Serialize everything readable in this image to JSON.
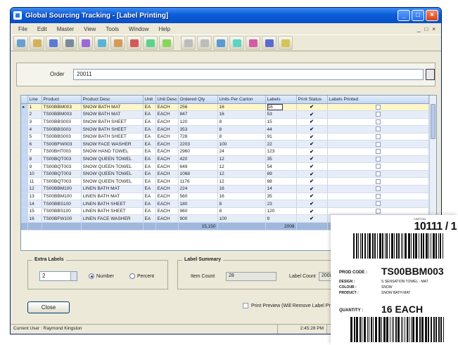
{
  "window": {
    "title": "Global Sourcing Tracking - [Label Printing]",
    "controls": [
      "_",
      "□",
      "×"
    ],
    "menu": [
      "File",
      "Edit",
      "Master",
      "View",
      "Tools",
      "Window",
      "Help"
    ],
    "mdi_controls": [
      "_",
      "□",
      "×"
    ]
  },
  "colors": {
    "titlebar": "#0b5cd8",
    "grid_header": "#c4d8f4",
    "selected_row": "#fff6c8",
    "alt_row": "#e6edf8",
    "total_row": "#9fb8dc"
  },
  "toolbar": {
    "buttons": [
      {
        "icon": "new-icon",
        "color": "#6a9fd4"
      },
      {
        "icon": "open-icon",
        "color": "#d4b25a"
      },
      {
        "icon": "save-icon",
        "color": "#5a7ad4"
      },
      {
        "icon": "print-icon",
        "color": "#7a8a9a"
      },
      {
        "icon": "cut-icon",
        "color": "#9a6ad4"
      },
      {
        "icon": "copy-icon",
        "color": "#5ab4d4"
      },
      {
        "icon": "paste-icon",
        "color": "#d49a5a"
      },
      {
        "icon": "delete-icon",
        "color": "#d45a5a"
      },
      {
        "icon": "find-icon",
        "color": "#5ad48a"
      },
      {
        "icon": "refresh-icon",
        "color": "#8ad45a"
      },
      {
        "icon": "first-icon",
        "color": "#bcbcbc"
      },
      {
        "icon": "prev-icon",
        "color": "#bcbcbc"
      },
      {
        "icon": "next-icon",
        "color": "#5a9ad4"
      },
      {
        "icon": "last-icon",
        "color": "#5ad4c4"
      },
      {
        "icon": "report-icon",
        "color": "#d45aa4"
      },
      {
        "icon": "help-icon",
        "color": "#5a6ad4"
      },
      {
        "icon": "exit-icon",
        "color": "#d4c45a"
      }
    ]
  },
  "order": {
    "label": "Order",
    "value": "20011"
  },
  "grid": {
    "columns": [
      "",
      "Line",
      "Product",
      "Product Desc",
      "Unit",
      "Unit Desc",
      "Ordered Qty",
      "Units Per Carton",
      "Labels",
      "Print Status",
      "Labels Printed"
    ],
    "rows": [
      [
        "1",
        "TS00BBM003",
        "SNOW BATH MAT",
        "EA",
        "EACH",
        "256",
        "16",
        "16",
        "✔",
        ""
      ],
      [
        "2",
        "TS00BBM003",
        "SNOW BATH MAT",
        "EA",
        "EACH",
        "847",
        "16",
        "53",
        "✔",
        ""
      ],
      [
        "3",
        "TS00BBS003",
        "SNOW BATH SHEET",
        "EA",
        "EACH",
        "120",
        "8",
        "15",
        "✔",
        ""
      ],
      [
        "4",
        "TS00BBS003",
        "SNOW BATH SHEET",
        "EA",
        "EACH",
        "353",
        "8",
        "44",
        "✔",
        ""
      ],
      [
        "5",
        "TS00BBS003",
        "SNOW BATH SHEET",
        "EA",
        "EACH",
        "728",
        "8",
        "91",
        "✔",
        ""
      ],
      [
        "6",
        "TS00BFW003",
        "SNOW FACE WASHER",
        "EA",
        "EACH",
        "2203",
        "100",
        "22",
        "✔",
        ""
      ],
      [
        "7",
        "TS00BHT003",
        "SNOW HAND TOWEL",
        "EA",
        "EACH",
        "2960",
        "24",
        "123",
        "✔",
        ""
      ],
      [
        "8",
        "TS00BQT003",
        "SNOW QUEEN TOWEL",
        "EA",
        "EACH",
        "420",
        "12",
        "35",
        "✔",
        ""
      ],
      [
        "9",
        "TS00BQT003",
        "SNOW QUEEN TOWEL",
        "EA",
        "EACH",
        "649",
        "12",
        "54",
        "✔",
        ""
      ],
      [
        "10",
        "TS00BQT003",
        "SNOW QUEEN TOWEL",
        "EA",
        "EACH",
        "1068",
        "12",
        "89",
        "✔",
        ""
      ],
      [
        "11",
        "TS00BQT003",
        "SNOW QUEEN TOWEL",
        "EA",
        "EACH",
        "1176",
        "12",
        "98",
        "✔",
        ""
      ],
      [
        "12",
        "TS00BBM100",
        "LINEN BATH MAT",
        "EA",
        "EACH",
        "224",
        "16",
        "14",
        "✔",
        ""
      ],
      [
        "13",
        "TS00BBM100",
        "LINEN BATH MAT",
        "EA",
        "EACH",
        "560",
        "16",
        "35",
        "✔",
        ""
      ],
      [
        "14",
        "TS00BBS100",
        "LINEN BATH SHEET",
        "EA",
        "EACH",
        "180",
        "8",
        "23",
        "✔",
        ""
      ],
      [
        "15",
        "TS00BBS100",
        "LINEN BATH SHEET",
        "EA",
        "EACH",
        "960",
        "8",
        "120",
        "✔",
        ""
      ],
      [
        "16",
        "TS00BFW100",
        "LINEN FACE WASHER",
        "EA",
        "EACH",
        "900",
        "100",
        "9",
        "✔",
        ""
      ]
    ],
    "selected_row": 0,
    "totals": {
      "ordered": "15,150",
      "labels": "2008"
    }
  },
  "extra_labels": {
    "title": "Extra Labels",
    "value": "2",
    "option_number": "Number",
    "option_percent": "Percent",
    "selected": "number"
  },
  "label_summary": {
    "title": "Label Summary",
    "item_count_label": "Item Count",
    "item_count": "28",
    "label_count_label": "Label Count",
    "label_count": "2008"
  },
  "close_label": "Close",
  "print_option": "Print Preview (Will Remove Label Printed...)",
  "status": {
    "user": "Current User : Raymond Kingston",
    "datetime": "2:45:28 PM",
    "spacer": ""
  },
  "label_card": {
    "carton_caption": "CARTON",
    "carton_number": "10111 / 1",
    "product_code_label": "PROD CODE :",
    "product_code": "TS00BBM003",
    "details": [
      {
        "label": "DESIGN :",
        "value": "S SENSATION TOWEL - MAT"
      },
      {
        "label": "COLOUR :",
        "value": "SNOW"
      },
      {
        "label": "PRODUCT :",
        "value": "SNOW BATH MAT"
      }
    ],
    "quantity_label": "QUANTITY :",
    "quantity": "16 EACH"
  }
}
